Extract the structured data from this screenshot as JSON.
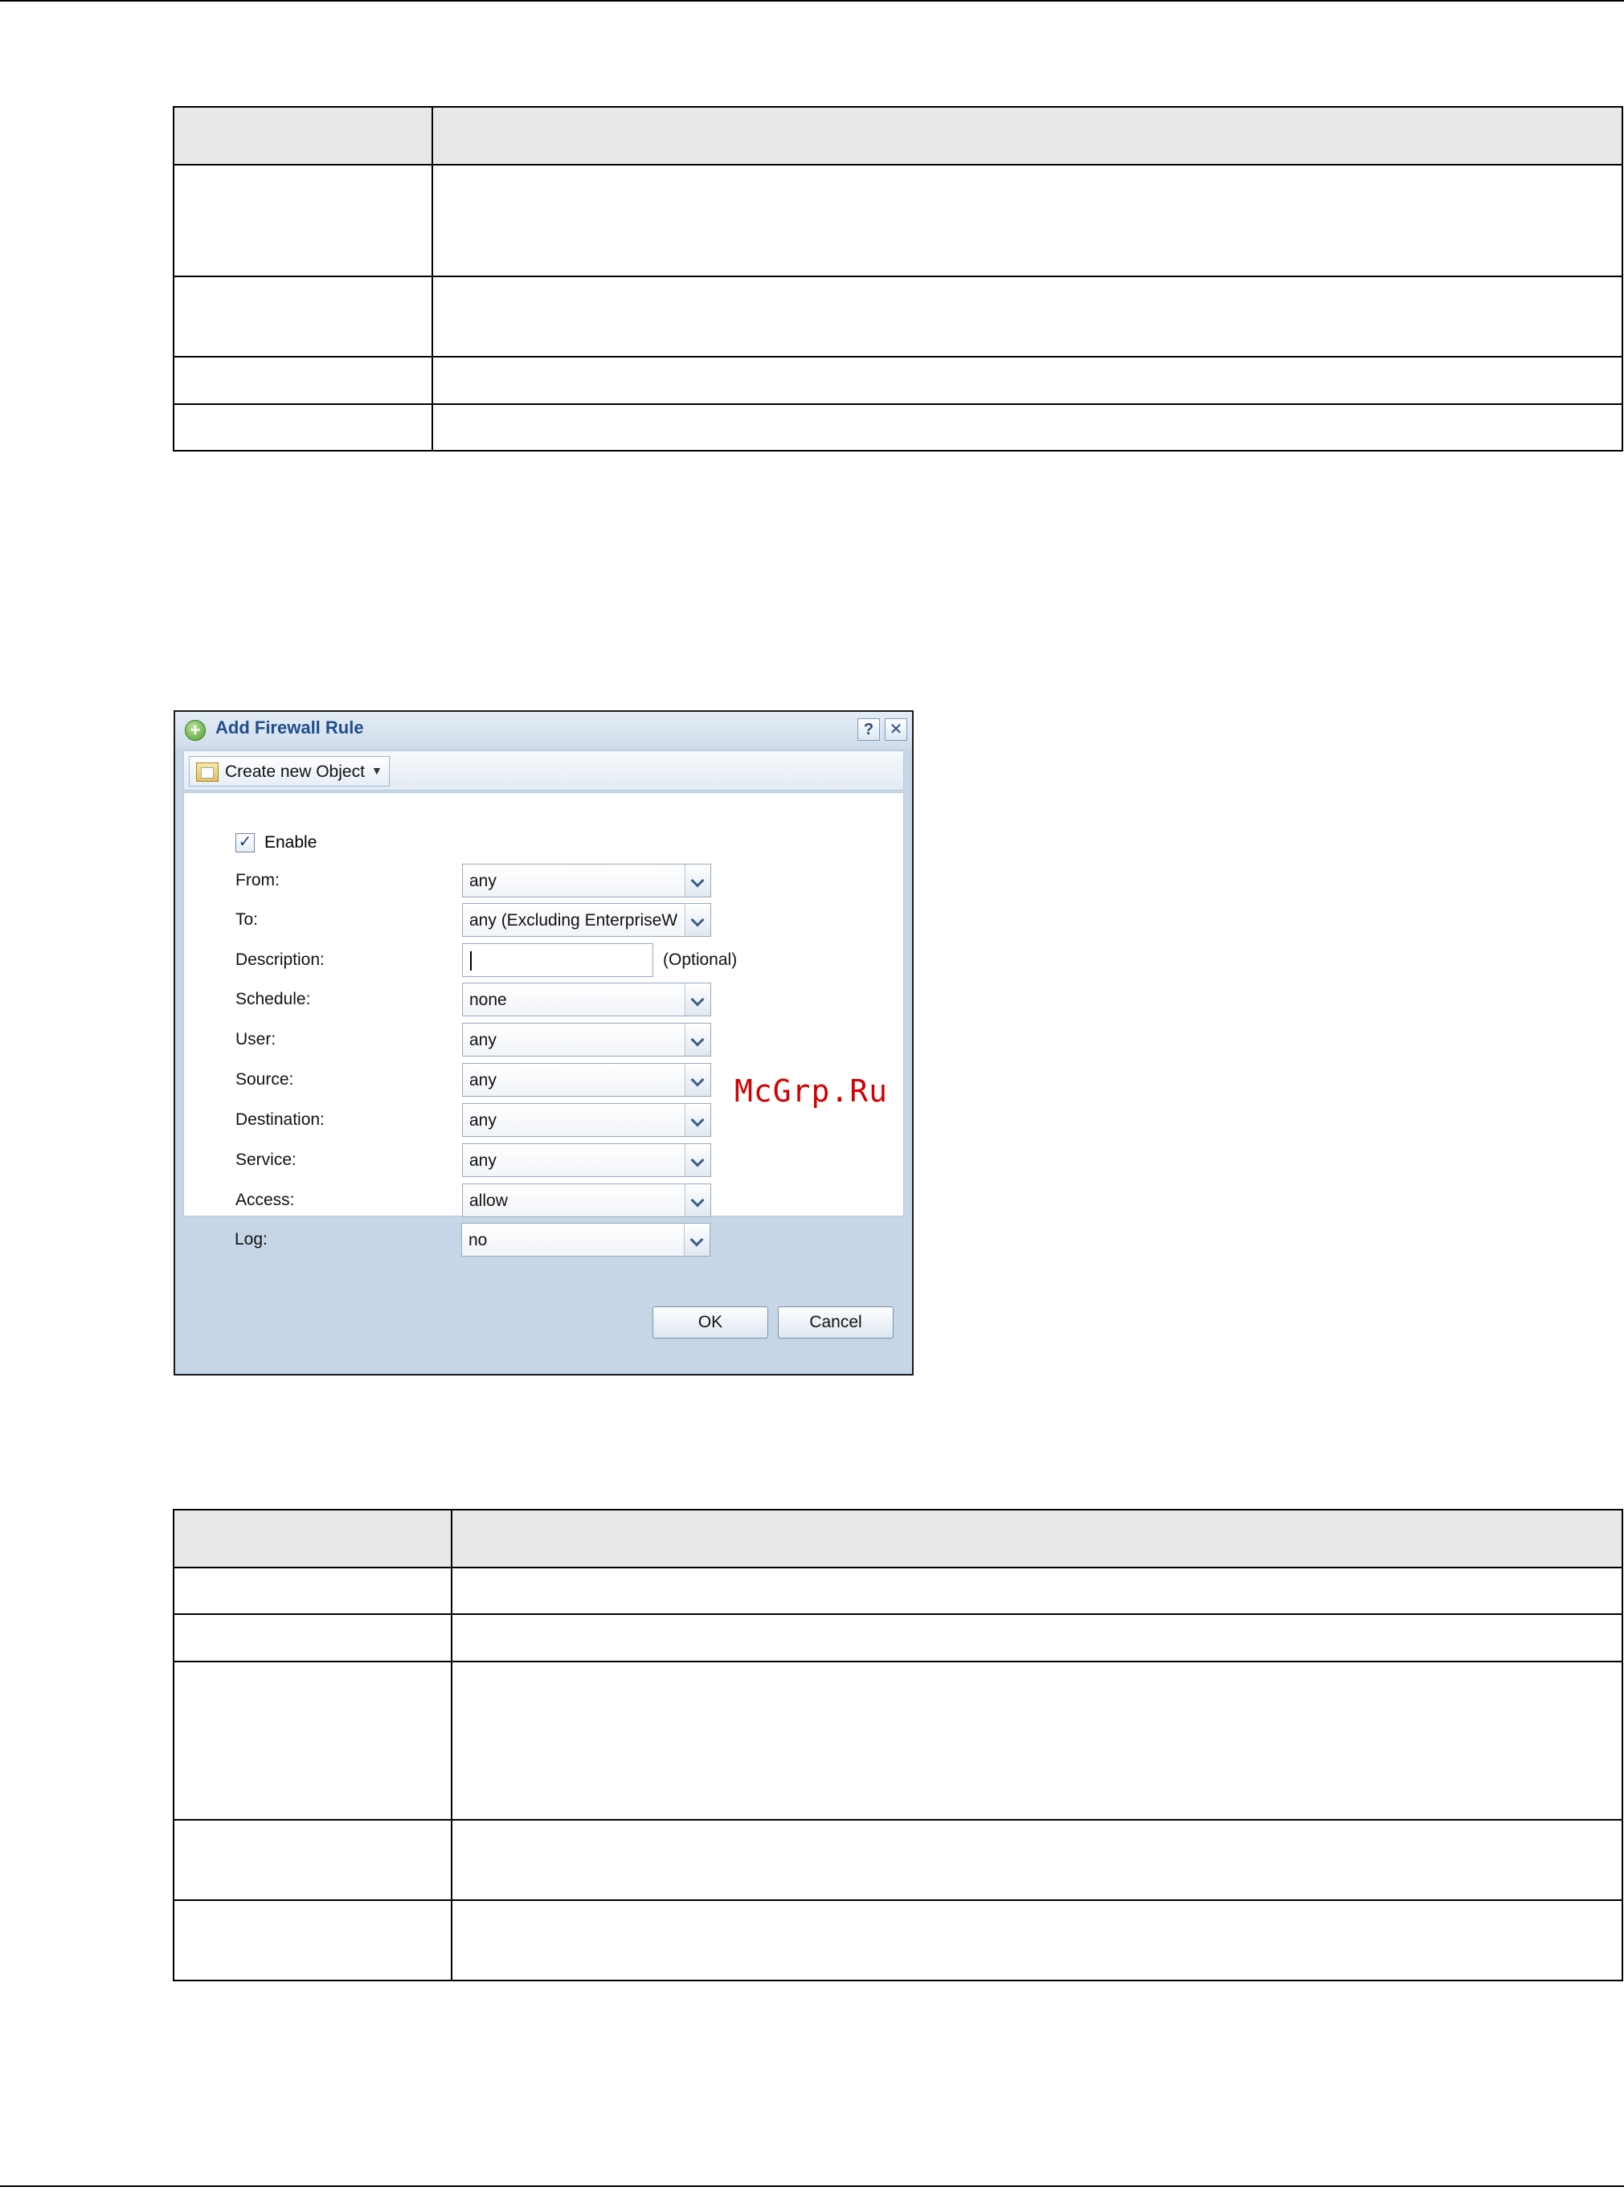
{
  "watermark": "McGrp.Ru",
  "dialog": {
    "title": "Add Firewall Rule",
    "help_symbol": "?",
    "close_symbol": "✕",
    "toolbar": {
      "create_label": "Create new Object",
      "create_caret": "▼"
    },
    "enable": {
      "label": "Enable",
      "checked": true,
      "check_mark": "✓"
    },
    "fields": [
      {
        "label": "From:",
        "value": "any"
      },
      {
        "label": "To:",
        "value": "any (Excluding EnterpriseWL"
      },
      {
        "label": "Description:",
        "value": "",
        "suffix": "(Optional)"
      },
      {
        "label": "Schedule:",
        "value": "none"
      },
      {
        "label": "User:",
        "value": "any"
      },
      {
        "label": "Source:",
        "value": "any"
      },
      {
        "label": "Destination:",
        "value": "any"
      },
      {
        "label": "Service:",
        "value": "any"
      },
      {
        "label": "Access:",
        "value": "allow"
      },
      {
        "label": "Log:",
        "value": "no"
      }
    ],
    "ok_label": "OK",
    "cancel_label": "Cancel"
  }
}
